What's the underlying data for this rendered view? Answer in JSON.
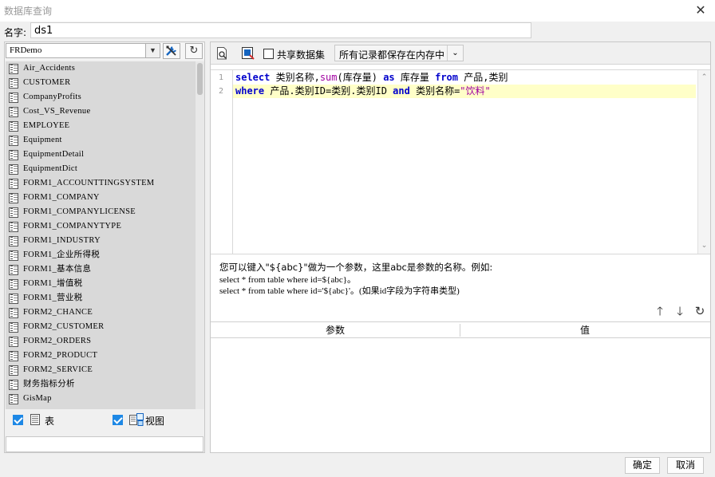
{
  "window": {
    "title": "数据库查询",
    "close_glyph": "✕"
  },
  "name_field": {
    "label": "名字:",
    "value": "ds1"
  },
  "left": {
    "connection": "FRDemo",
    "tables": [
      "Air_Accidents",
      "CUSTOMER",
      "CompanyProfits",
      "Cost_VS_Revenue",
      "EMPLOYEE",
      "Equipment",
      "EquipmentDetail",
      "EquipmentDict",
      "FORM1_ACCOUNTTINGSYSTEM",
      "FORM1_COMPANY",
      "FORM1_COMPANYLICENSE",
      "FORM1_COMPANYTYPE",
      "FORM1_INDUSTRY",
      "FORM1_企业所得税",
      "FORM1_基本信息",
      "FORM1_增值税",
      "FORM1_营业税",
      "FORM2_CHANCE",
      "FORM2_CUSTOMER",
      "FORM2_ORDERS",
      "FORM2_PRODUCT",
      "FORM2_SERVICE",
      "财务指标分析",
      "GisMap"
    ],
    "show_tables": {
      "label": "表",
      "checked": true
    },
    "show_views": {
      "label": "视图",
      "checked": true
    }
  },
  "toolbar": {
    "share_label": "共享数据集",
    "memory_option": "所有记录都保存在内存中"
  },
  "editor": {
    "line_numbers": [
      "1",
      "2"
    ]
  },
  "help": {
    "line1": "您可以键入\"${abc}\"做为一个参数，这里abc是参数的名称。例如:",
    "line2": "select * from table where id=${abc}。",
    "line3": "select * from table where id='${abc}'。(如果id字段为字符串类型)"
  },
  "params": {
    "col_name": "参数",
    "col_value": "值"
  },
  "footer": {
    "ok": "确定",
    "cancel": "取消"
  },
  "colors": {
    "keyword": "#0000cc",
    "function": "#a000a0",
    "active_line": "#ffffc8",
    "checkbox": "#1e88e5"
  }
}
